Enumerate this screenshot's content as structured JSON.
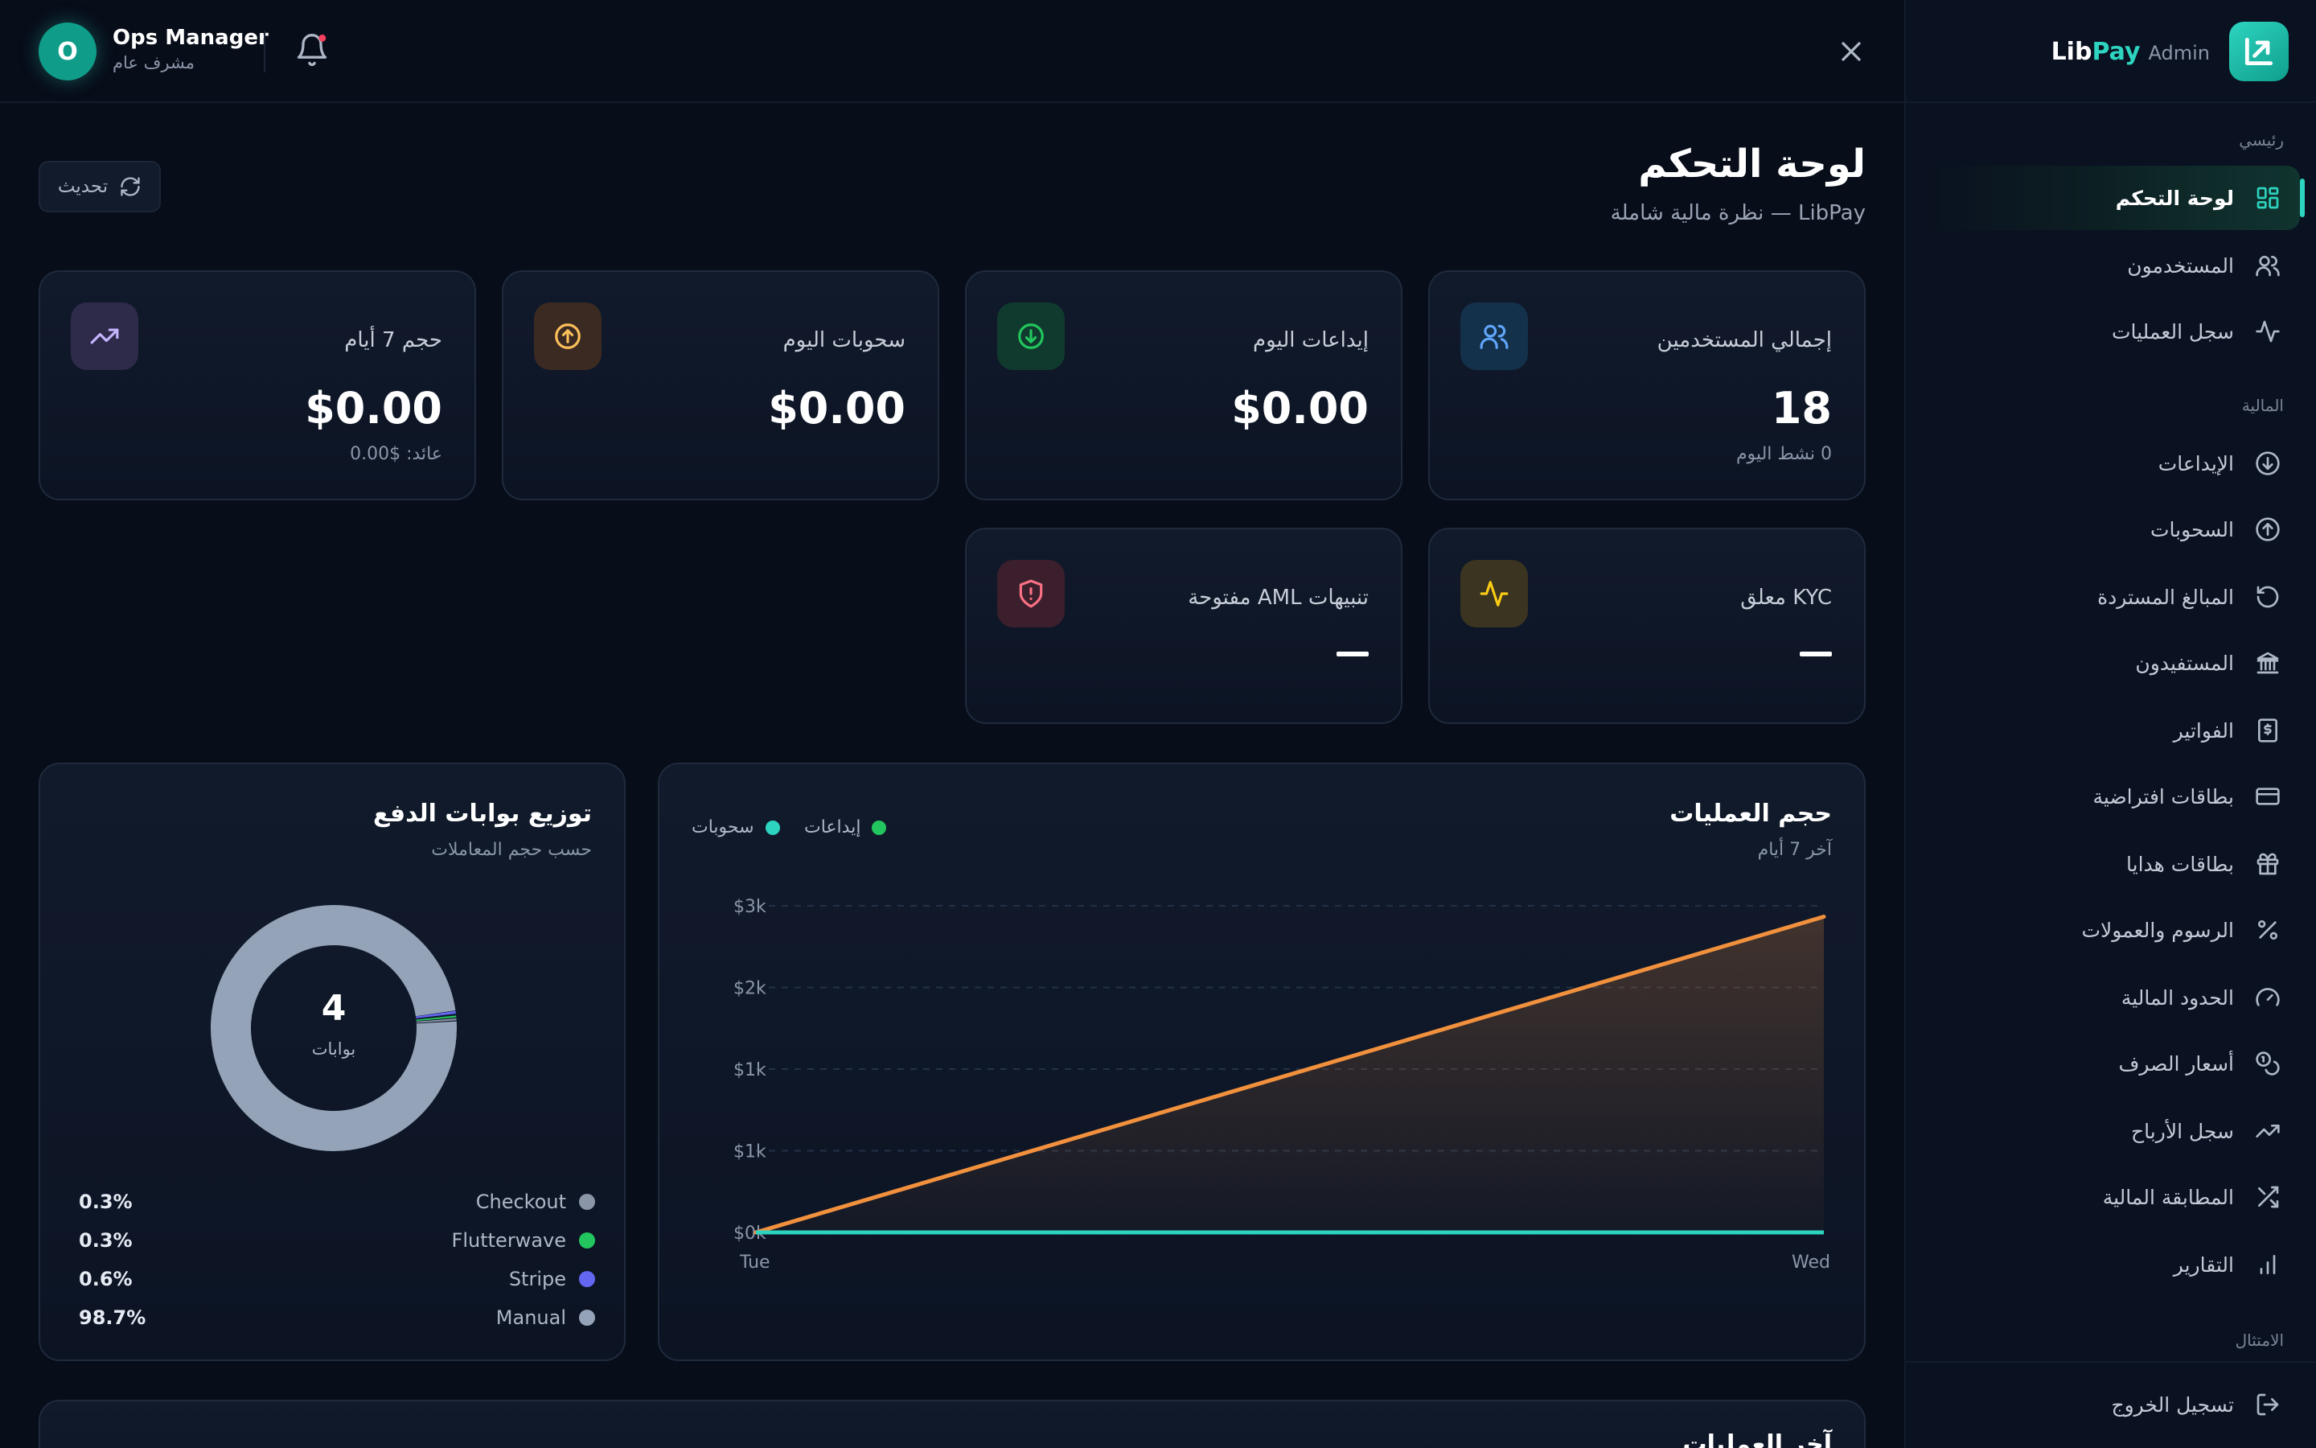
{
  "brand": {
    "lib": "Lib",
    "pay": "Pay",
    "admin": "Admin"
  },
  "sidebar": {
    "sections": [
      "رئيسي",
      "المالية",
      "الامتثال"
    ],
    "main_items": [
      {
        "label": "لوحة التحكم",
        "icon": "dashboard-grid-icon",
        "active": true
      },
      {
        "label": "المستخدمون",
        "icon": "users-icon"
      },
      {
        "label": "سجل العمليات",
        "icon": "activity-icon"
      }
    ],
    "finance_items": [
      {
        "label": "الإيداعات",
        "icon": "arrow-down-circle-icon"
      },
      {
        "label": "السحوبات",
        "icon": "arrow-up-circle-icon"
      },
      {
        "label": "المبالغ المستردة",
        "icon": "rotate-ccw-icon"
      },
      {
        "label": "المستفيدون",
        "icon": "bank-icon"
      },
      {
        "label": "الفواتير",
        "icon": "invoice-icon"
      },
      {
        "label": "بطاقات افتراضية",
        "icon": "credit-card-icon"
      },
      {
        "label": "بطاقات هدايا",
        "icon": "gift-icon"
      },
      {
        "label": "الرسوم والعمولات",
        "icon": "percent-icon"
      },
      {
        "label": "الحدود المالية",
        "icon": "gauge-icon"
      },
      {
        "label": "أسعار الصرف",
        "icon": "coins-icon"
      },
      {
        "label": "سجل الأرباح",
        "icon": "trending-up-icon"
      },
      {
        "label": "المطابقة المالية",
        "icon": "shuffle-icon"
      },
      {
        "label": "التقارير",
        "icon": "bar-chart-icon"
      }
    ],
    "logout": "تسجيل الخروج"
  },
  "topbar": {
    "avatar_initial": "O",
    "user_name": "Ops Manager",
    "user_role": "مشرف عام"
  },
  "header": {
    "title": "لوحة التحكم",
    "subtitle": "LibPay — نظرة مالية شاملة",
    "refresh_label": "تحديث"
  },
  "stats": {
    "total_users": {
      "title": "إجمالي المستخدمين",
      "value": "18",
      "sub": "0 نشط اليوم"
    },
    "deposits_today": {
      "title": "إيداعات اليوم",
      "value": "$0.00"
    },
    "withdrawals_today": {
      "title": "سحوبات اليوم",
      "value": "$0.00"
    },
    "volume_7d": {
      "title": "حجم 7 أيام",
      "value": "$0.00",
      "sub": "عائد: $0.00"
    },
    "kyc_pending": {
      "title": "KYC معلق"
    },
    "aml_alerts": {
      "title": "تنبيهات AML مفتوحة"
    }
  },
  "colors": {
    "accent": "#2dd4bf",
    "deposits": "#22c55e",
    "withdrawals": "#2dd4bf",
    "line": "#f2913d"
  },
  "volume_chart": {
    "title": "حجم العمليات",
    "subtitle": "آخر 7 أيام",
    "legend": {
      "deposits": "إيداعات",
      "withdrawals": "سحوبات"
    }
  },
  "gateway_chart": {
    "title": "توزيع بوابات الدفع",
    "subtitle": "حسب حجم المعاملات",
    "center_value": "4",
    "center_label": "بوابات"
  },
  "chart_data": [
    {
      "type": "area",
      "title": "حجم العمليات",
      "x": [
        "Tue",
        "Wed"
      ],
      "y_ticks": [
        "$0k",
        "$1k",
        "$1k",
        "$2k",
        "$3k"
      ],
      "ylim": [
        0,
        3000
      ],
      "grid": true,
      "legend_position": "top-left",
      "series": [
        {
          "name": "إيداعات",
          "color": "#f2913d",
          "values": [
            0,
            2900
          ]
        },
        {
          "name": "سحوبات",
          "color": "#2dd4bf",
          "values": [
            0,
            0
          ]
        }
      ]
    },
    {
      "type": "pie",
      "title": "توزيع بوابات الدفع",
      "series": [
        {
          "name": "Checkout",
          "value": 0.3,
          "label": "0.3%",
          "color": "#8b95a8"
        },
        {
          "name": "Flutterwave",
          "value": 0.3,
          "label": "0.3%",
          "color": "#22c55e"
        },
        {
          "name": "Stripe",
          "value": 0.6,
          "label": "0.6%",
          "color": "#6366f1"
        },
        {
          "name": "Manual",
          "value": 98.7,
          "label": "98.7%",
          "color": "#94a3b8"
        }
      ]
    }
  ],
  "footer_section": {
    "title": "آخر العمليات"
  }
}
